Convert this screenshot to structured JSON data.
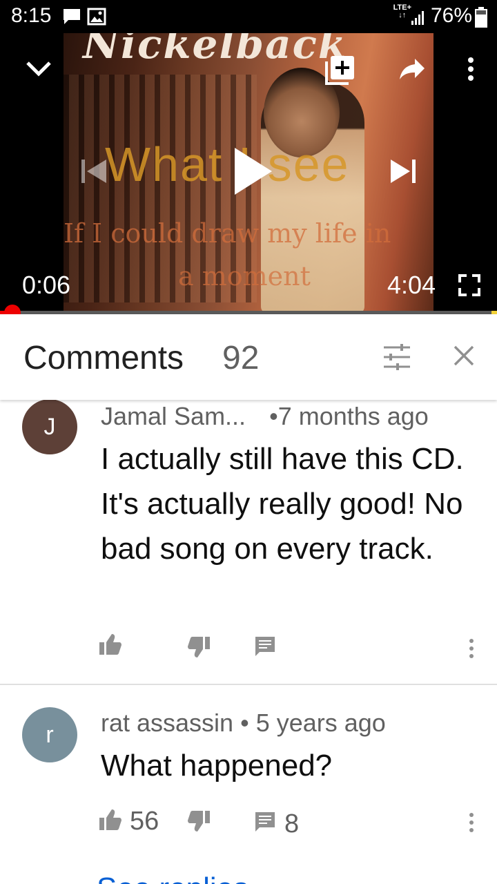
{
  "status_bar": {
    "time": "8:15",
    "network": "LTE+",
    "battery": "76%"
  },
  "player": {
    "current_time": "0:06",
    "duration": "4:04",
    "progress_fraction": 0.0246,
    "album_art": {
      "band_title": "Nickelback",
      "song_title": "What I see",
      "subtitle_line1": "If I could draw my life in",
      "subtitle_line2": "a moment"
    }
  },
  "comments_header": {
    "title": "Comments",
    "count": "92"
  },
  "comments": [
    {
      "avatar_letter": "J",
      "avatar_color": "#5d4037",
      "author": "Jamal Sam...",
      "age": "7 months ago",
      "text": "I actually still have this CD. It's actually really good! No bad song on every track.",
      "likes": "",
      "replies": ""
    },
    {
      "avatar_letter": "r",
      "avatar_color": "#78909c",
      "author": "rat assassin",
      "age": "5 years ago",
      "text": "What happened?",
      "likes": "56",
      "replies": "8"
    }
  ],
  "see_more": "See replies",
  "colors": {
    "progress": "#ee0000",
    "link": "#065fd4"
  }
}
